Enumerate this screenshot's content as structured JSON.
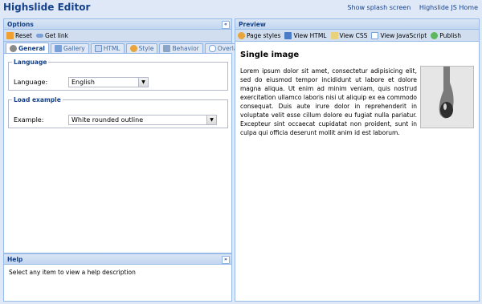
{
  "app": {
    "title": "Highslide Editor"
  },
  "top_links": [
    "Show splash screen",
    "Highslide JS Home"
  ],
  "options": {
    "header": "Options",
    "toolbar": {
      "reset": "Reset",
      "get_link": "Get link"
    },
    "tabs": [
      "General",
      "Gallery",
      "HTML",
      "Style",
      "Behavior",
      "Overlays"
    ],
    "language_section": {
      "legend": "Language",
      "label": "Language:",
      "value": "English"
    },
    "example_section": {
      "legend": "Load example",
      "label": "Example:",
      "value": "White rounded outline"
    }
  },
  "help": {
    "header": "Help",
    "text": "Select any item to view a help description"
  },
  "preview": {
    "header": "Preview",
    "toolbar": [
      "Page styles",
      "View HTML",
      "View CSS",
      "View JavaScript",
      "Publish"
    ],
    "title": "Single image",
    "body": "Lorem ipsum dolor sit amet, consectetur adipisicing elit, sed do eiusmod tempor incididunt ut labore et dolore magna aliqua. Ut enim ad minim veniam, quis nostrud exercitation ullamco laboris nisi ut aliquip ex ea commodo consequat. Duis aute irure dolor in reprehenderit in voluptate velit esse cillum dolore eu fugiat nulla pariatur. Excepteur sint occaecat cupidatat non proident, sunt in culpa qui officia deserunt mollit anim id est laborum."
  }
}
